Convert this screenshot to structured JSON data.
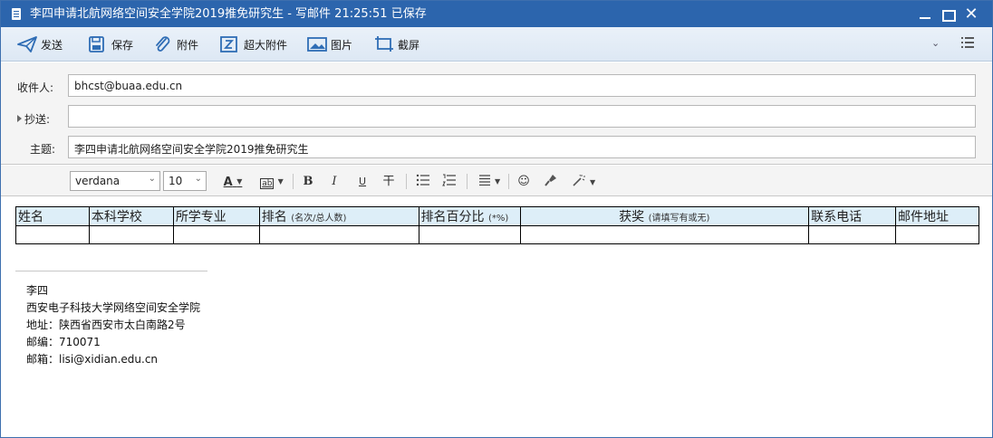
{
  "window": {
    "title": "李四申请北航网络空间安全学院2019推免研究生 - 写邮件   21:25:51 已保存"
  },
  "toolbar": {
    "send": "发送",
    "save": "保存",
    "attach": "附件",
    "big_attach": "超大附件",
    "image": "图片",
    "screenshot": "截屏",
    "icons": [
      "send-icon",
      "save-icon",
      "paperclip-icon",
      "big-attachment-icon",
      "image-icon",
      "screenshot-icon",
      "chevron-down-icon",
      "list-icon"
    ]
  },
  "fields": {
    "to_label": "收件人:",
    "to_value": "bhcst@buaa.edu.cn",
    "cc_label": "抄送:",
    "cc_value": "",
    "subject_label": "主题:",
    "subject_value": "李四申请北航网络空间安全学院2019推免研究生"
  },
  "format": {
    "font": "verdana",
    "size": "10",
    "bold": "B",
    "italic": "I",
    "underline": "U",
    "strike": "干",
    "text_color_glyph": "A",
    "bg_color_glyph": "ab"
  },
  "table": {
    "headers": [
      {
        "main": "姓名",
        "sub": ""
      },
      {
        "main": "本科学校",
        "sub": ""
      },
      {
        "main": "所学专业",
        "sub": ""
      },
      {
        "main": "排名",
        "sub": "(名次/总人数)"
      },
      {
        "main": "排名百分比",
        "sub": "(*%)"
      },
      {
        "main": "获奖",
        "sub": "(请填写有或无)"
      },
      {
        "main": "联系电话",
        "sub": ""
      },
      {
        "main": "邮件地址",
        "sub": ""
      }
    ]
  },
  "signature": {
    "name": "李四",
    "school": "西安电子科技大学网络空间安全学院",
    "address": "地址：陕西省西安市太白南路2号",
    "postcode": "邮编：710071",
    "email": "邮箱：lisi@xidian.edu.cn"
  },
  "colors": {
    "titlebar": "#2c65ad",
    "toolbar_icon": "#2f6db5",
    "table_header": "#ddeef8"
  }
}
